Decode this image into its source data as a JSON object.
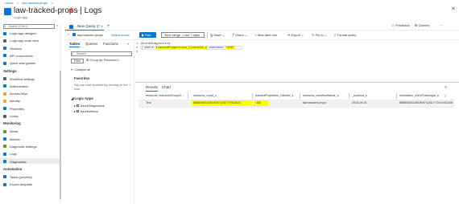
{
  "header": {
    "breadcrumb": [
      "Home",
      ">",
      "law-tracked-props",
      ">"
    ],
    "title": "law-tracked-props | Logs",
    "subtitle": "Logic app",
    "pin_icon": "pin-icon",
    "more_icon": "ellipsis-icon",
    "close_label": "✕"
  },
  "nav": {
    "search_placeholder": "Search (Ctrl+/)",
    "collapse_glyph": "«",
    "items_top": [
      {
        "label": "Logic app designer",
        "color": "#0078d4"
      },
      {
        "label": "Logic app code view",
        "color": "#605e5c"
      },
      {
        "label": "Versions",
        "color": "#0078d4"
      },
      {
        "label": "API connections",
        "color": "#0078d4"
      },
      {
        "label": "Quick start guides",
        "color": "#0078d4"
      }
    ],
    "settings_heading": "Settings",
    "items_settings": [
      {
        "label": "Workflow settings",
        "color": "#605e5c"
      },
      {
        "label": "Authorization",
        "color": "#0078d4"
      },
      {
        "label": "Access keys",
        "color": "#e8a33d"
      },
      {
        "label": "Identity",
        "color": "#e8a33d"
      },
      {
        "label": "Properties",
        "color": "#0078d4"
      },
      {
        "label": "Locks",
        "color": "#605e5c"
      }
    ],
    "monitoring_heading": "Monitoring",
    "items_monitoring": [
      {
        "label": "Alerts",
        "color": "#57a300"
      },
      {
        "label": "Metrics",
        "color": "#0078d4"
      },
      {
        "label": "Diagnostic settings",
        "color": "#57a300"
      },
      {
        "label": "Logs",
        "color": "#0078d4"
      },
      {
        "label": "Diagnostics",
        "color": "#0078d4"
      }
    ],
    "automation_heading": "Automation",
    "items_automation": [
      {
        "label": "Tasks (preview)",
        "color": "#0078d4"
      },
      {
        "label": "Export template",
        "color": "#0078d4"
      }
    ]
  },
  "query_tabs": {
    "active_label": "New Query 1*",
    "close_glyph": "✕",
    "add_glyph": "+",
    "right_links": [
      "Feedback",
      "Queries",
      "⋯"
    ]
  },
  "toolbar": {
    "scope_name": "law-tracked-props",
    "select_scope": "Select scope",
    "run_label": "Run",
    "time_range": "Time range : Last 7 days",
    "items": [
      "Save",
      "Share",
      "New alert rule",
      "Export",
      "Pin to",
      "Format query"
    ]
  },
  "pane": {
    "tabs": [
      "Tables",
      "Queries",
      "Functions"
    ],
    "collapse_glyph": "«",
    "search_placeholder": "Search",
    "filter_label": "Filter",
    "group_by": "Group by: Resource t...",
    "collapse_all": "Collapse all",
    "favorites_heading": "Favorites",
    "favorites_desc": "You can add favorites by clicking on the ☆ icon",
    "logic_apps_heading": "Logic Apps",
    "tree": [
      "AzureDiagnostics",
      "AzureMetrics"
    ]
  },
  "editor": {
    "line_numbers": "1\n2\n3",
    "line1": "AzureDiagnostics",
    "line2_prefix": "| where ",
    "line2_highlight": "trackedProperties_ClientId_s",
    "line2_mid": " contains ",
    "line2_string": "\"456\"",
    "line3": ""
  },
  "results": {
    "tabs": [
      "Results",
      "Chart"
    ],
    "columns": [
      "resource_resourceGroupN...",
      "resource_runId_s",
      "trackedProperties_ClientId_s",
      "resource_workflowName_s",
      "_schema_s",
      "correlation_clientTrackingId_s"
    ],
    "rows": [
      [
        "Test",
        "08585483148186971181772414472",
        "456",
        "law-tracked-props",
        "2016-06-01",
        "0858548314818697118117724144CU06"
      ]
    ]
  }
}
